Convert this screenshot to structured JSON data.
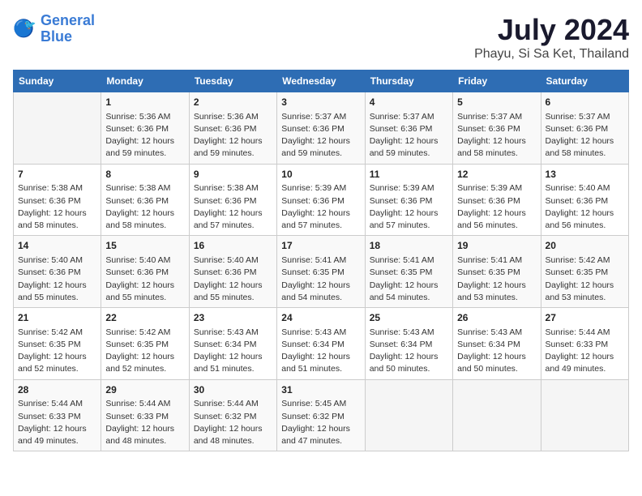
{
  "header": {
    "logo_line1": "General",
    "logo_line2": "Blue",
    "month_year": "July 2024",
    "location": "Phayu, Si Sa Ket, Thailand"
  },
  "days_of_week": [
    "Sunday",
    "Monday",
    "Tuesday",
    "Wednesday",
    "Thursday",
    "Friday",
    "Saturday"
  ],
  "weeks": [
    [
      {
        "num": "",
        "info": ""
      },
      {
        "num": "1",
        "info": "Sunrise: 5:36 AM\nSunset: 6:36 PM\nDaylight: 12 hours\nand 59 minutes."
      },
      {
        "num": "2",
        "info": "Sunrise: 5:36 AM\nSunset: 6:36 PM\nDaylight: 12 hours\nand 59 minutes."
      },
      {
        "num": "3",
        "info": "Sunrise: 5:37 AM\nSunset: 6:36 PM\nDaylight: 12 hours\nand 59 minutes."
      },
      {
        "num": "4",
        "info": "Sunrise: 5:37 AM\nSunset: 6:36 PM\nDaylight: 12 hours\nand 59 minutes."
      },
      {
        "num": "5",
        "info": "Sunrise: 5:37 AM\nSunset: 6:36 PM\nDaylight: 12 hours\nand 58 minutes."
      },
      {
        "num": "6",
        "info": "Sunrise: 5:37 AM\nSunset: 6:36 PM\nDaylight: 12 hours\nand 58 minutes."
      }
    ],
    [
      {
        "num": "7",
        "info": "Sunrise: 5:38 AM\nSunset: 6:36 PM\nDaylight: 12 hours\nand 58 minutes."
      },
      {
        "num": "8",
        "info": "Sunrise: 5:38 AM\nSunset: 6:36 PM\nDaylight: 12 hours\nand 58 minutes."
      },
      {
        "num": "9",
        "info": "Sunrise: 5:38 AM\nSunset: 6:36 PM\nDaylight: 12 hours\nand 57 minutes."
      },
      {
        "num": "10",
        "info": "Sunrise: 5:39 AM\nSunset: 6:36 PM\nDaylight: 12 hours\nand 57 minutes."
      },
      {
        "num": "11",
        "info": "Sunrise: 5:39 AM\nSunset: 6:36 PM\nDaylight: 12 hours\nand 57 minutes."
      },
      {
        "num": "12",
        "info": "Sunrise: 5:39 AM\nSunset: 6:36 PM\nDaylight: 12 hours\nand 56 minutes."
      },
      {
        "num": "13",
        "info": "Sunrise: 5:40 AM\nSunset: 6:36 PM\nDaylight: 12 hours\nand 56 minutes."
      }
    ],
    [
      {
        "num": "14",
        "info": "Sunrise: 5:40 AM\nSunset: 6:36 PM\nDaylight: 12 hours\nand 55 minutes."
      },
      {
        "num": "15",
        "info": "Sunrise: 5:40 AM\nSunset: 6:36 PM\nDaylight: 12 hours\nand 55 minutes."
      },
      {
        "num": "16",
        "info": "Sunrise: 5:40 AM\nSunset: 6:36 PM\nDaylight: 12 hours\nand 55 minutes."
      },
      {
        "num": "17",
        "info": "Sunrise: 5:41 AM\nSunset: 6:35 PM\nDaylight: 12 hours\nand 54 minutes."
      },
      {
        "num": "18",
        "info": "Sunrise: 5:41 AM\nSunset: 6:35 PM\nDaylight: 12 hours\nand 54 minutes."
      },
      {
        "num": "19",
        "info": "Sunrise: 5:41 AM\nSunset: 6:35 PM\nDaylight: 12 hours\nand 53 minutes."
      },
      {
        "num": "20",
        "info": "Sunrise: 5:42 AM\nSunset: 6:35 PM\nDaylight: 12 hours\nand 53 minutes."
      }
    ],
    [
      {
        "num": "21",
        "info": "Sunrise: 5:42 AM\nSunset: 6:35 PM\nDaylight: 12 hours\nand 52 minutes."
      },
      {
        "num": "22",
        "info": "Sunrise: 5:42 AM\nSunset: 6:35 PM\nDaylight: 12 hours\nand 52 minutes."
      },
      {
        "num": "23",
        "info": "Sunrise: 5:43 AM\nSunset: 6:34 PM\nDaylight: 12 hours\nand 51 minutes."
      },
      {
        "num": "24",
        "info": "Sunrise: 5:43 AM\nSunset: 6:34 PM\nDaylight: 12 hours\nand 51 minutes."
      },
      {
        "num": "25",
        "info": "Sunrise: 5:43 AM\nSunset: 6:34 PM\nDaylight: 12 hours\nand 50 minutes."
      },
      {
        "num": "26",
        "info": "Sunrise: 5:43 AM\nSunset: 6:34 PM\nDaylight: 12 hours\nand 50 minutes."
      },
      {
        "num": "27",
        "info": "Sunrise: 5:44 AM\nSunset: 6:33 PM\nDaylight: 12 hours\nand 49 minutes."
      }
    ],
    [
      {
        "num": "28",
        "info": "Sunrise: 5:44 AM\nSunset: 6:33 PM\nDaylight: 12 hours\nand 49 minutes."
      },
      {
        "num": "29",
        "info": "Sunrise: 5:44 AM\nSunset: 6:33 PM\nDaylight: 12 hours\nand 48 minutes."
      },
      {
        "num": "30",
        "info": "Sunrise: 5:44 AM\nSunset: 6:32 PM\nDaylight: 12 hours\nand 48 minutes."
      },
      {
        "num": "31",
        "info": "Sunrise: 5:45 AM\nSunset: 6:32 PM\nDaylight: 12 hours\nand 47 minutes."
      },
      {
        "num": "",
        "info": ""
      },
      {
        "num": "",
        "info": ""
      },
      {
        "num": "",
        "info": ""
      }
    ]
  ]
}
